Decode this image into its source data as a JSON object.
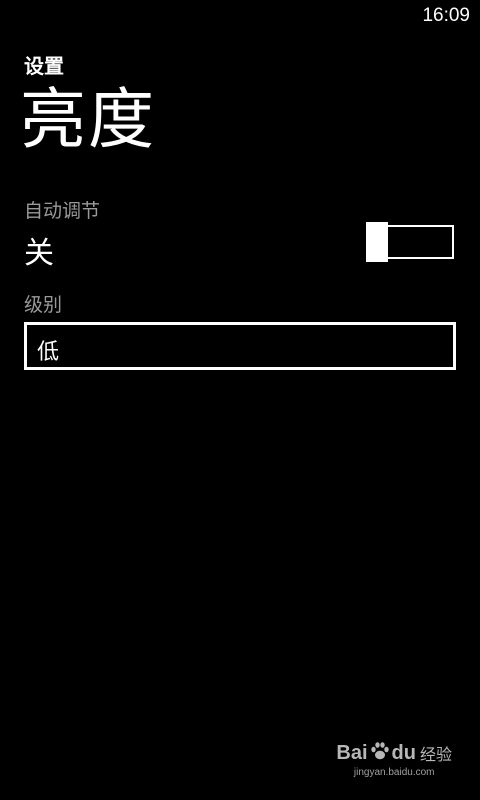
{
  "status_bar": {
    "time": "16:09"
  },
  "header": {
    "app_title": "设置",
    "page_title": "亮度"
  },
  "auto_adjust": {
    "label": "自动调节",
    "value": "关",
    "toggle_on": false
  },
  "level": {
    "label": "级别",
    "selected": "低"
  },
  "watermark": {
    "brand_left": "Bai",
    "brand_right": "du",
    "product": "经验",
    "url": "jingyan.baidu.com"
  },
  "colors": {
    "background": "#000000",
    "foreground": "#ffffff",
    "subtle_label": "#999999"
  }
}
